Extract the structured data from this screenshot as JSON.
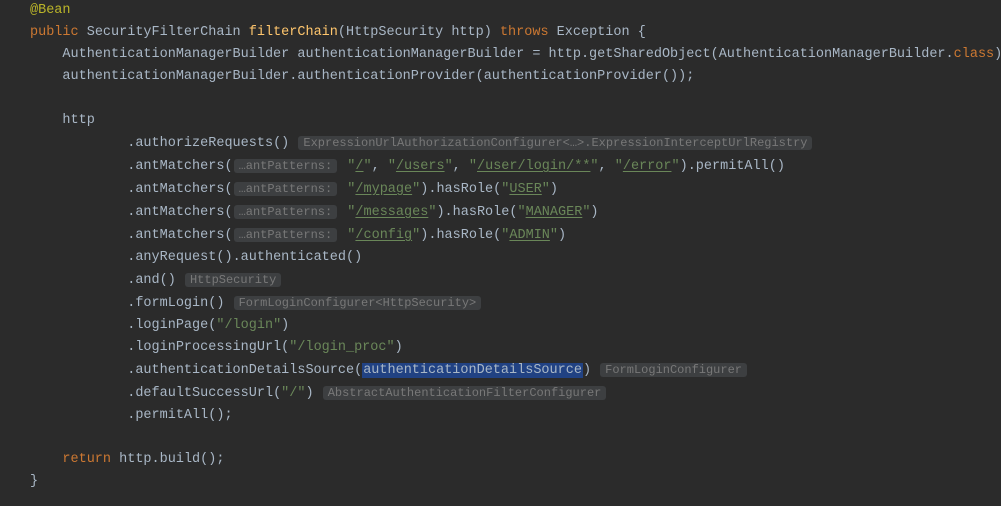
{
  "code": {
    "annotation": "@Bean",
    "kw_public": "public",
    "kw_throws": "throws",
    "kw_return": "return",
    "kw_class": "class",
    "type_sfc": "SecurityFilterChain",
    "method_decl": "filterChain",
    "type_httpsec": "HttpSecurity",
    "param_http": "http",
    "type_exception": "Exception",
    "type_amb": "AuthenticationManagerBuilder",
    "var_amb": "authenticationManagerBuilder",
    "call_getSharedObject": "getSharedObject",
    "call_authProvider": "authenticationProvider",
    "id_authProvider": "authenticationProvider",
    "chain_authorizeRequests": "authorizeRequests",
    "hint_expr": "ExpressionUrlAuthorizationConfigurer<…>.ExpressionInterceptUrlRegistry",
    "chain_antMatchers": "antMatchers",
    "hint_antPatterns": "…antPatterns:",
    "str_root": "/",
    "str_users": "/users",
    "str_userLogin": "/user/login/**",
    "str_error": "/error",
    "call_permitAll": "permitAll",
    "str_mypage": "/mypage",
    "call_hasRole": "hasRole",
    "role_user": "USER",
    "str_messages": "/messages",
    "role_manager": "MANAGER",
    "str_config": "/config",
    "role_admin": "ADMIN",
    "chain_anyRequest": "anyRequest",
    "chain_authenticated": "authenticated",
    "chain_and": "and",
    "hint_httpSecurity": "HttpSecurity",
    "chain_formLogin": "formLogin",
    "hint_formLoginConfigurerHttp": "FormLoginConfigurer<HttpSecurity>",
    "chain_loginPage": "loginPage",
    "str_login": "\"/login\"",
    "chain_loginProcessingUrl": "loginProcessingUrl",
    "str_login_proc": "\"/login_proc\"",
    "chain_authDetailsSource": "authenticationDetailsSource",
    "id_authDetailsSource": "authenticationDetailsSource",
    "hint_formLoginConfigurer": "FormLoginConfigurer",
    "chain_defaultSuccessUrl": "defaultSuccessUrl",
    "str_root2": "\"/\"",
    "hint_abstractAuthFilter": "AbstractAuthenticationFilterConfigurer",
    "chain_permitAll_last": "permitAll",
    "id_build": "build",
    "q": "\"",
    "lbrace": "{",
    "rbrace": "}",
    "lparen": "(",
    "rparen": ")",
    "semi": ";",
    "comma": ",",
    "dot": ".",
    "eq": "=",
    "sp": " "
  }
}
